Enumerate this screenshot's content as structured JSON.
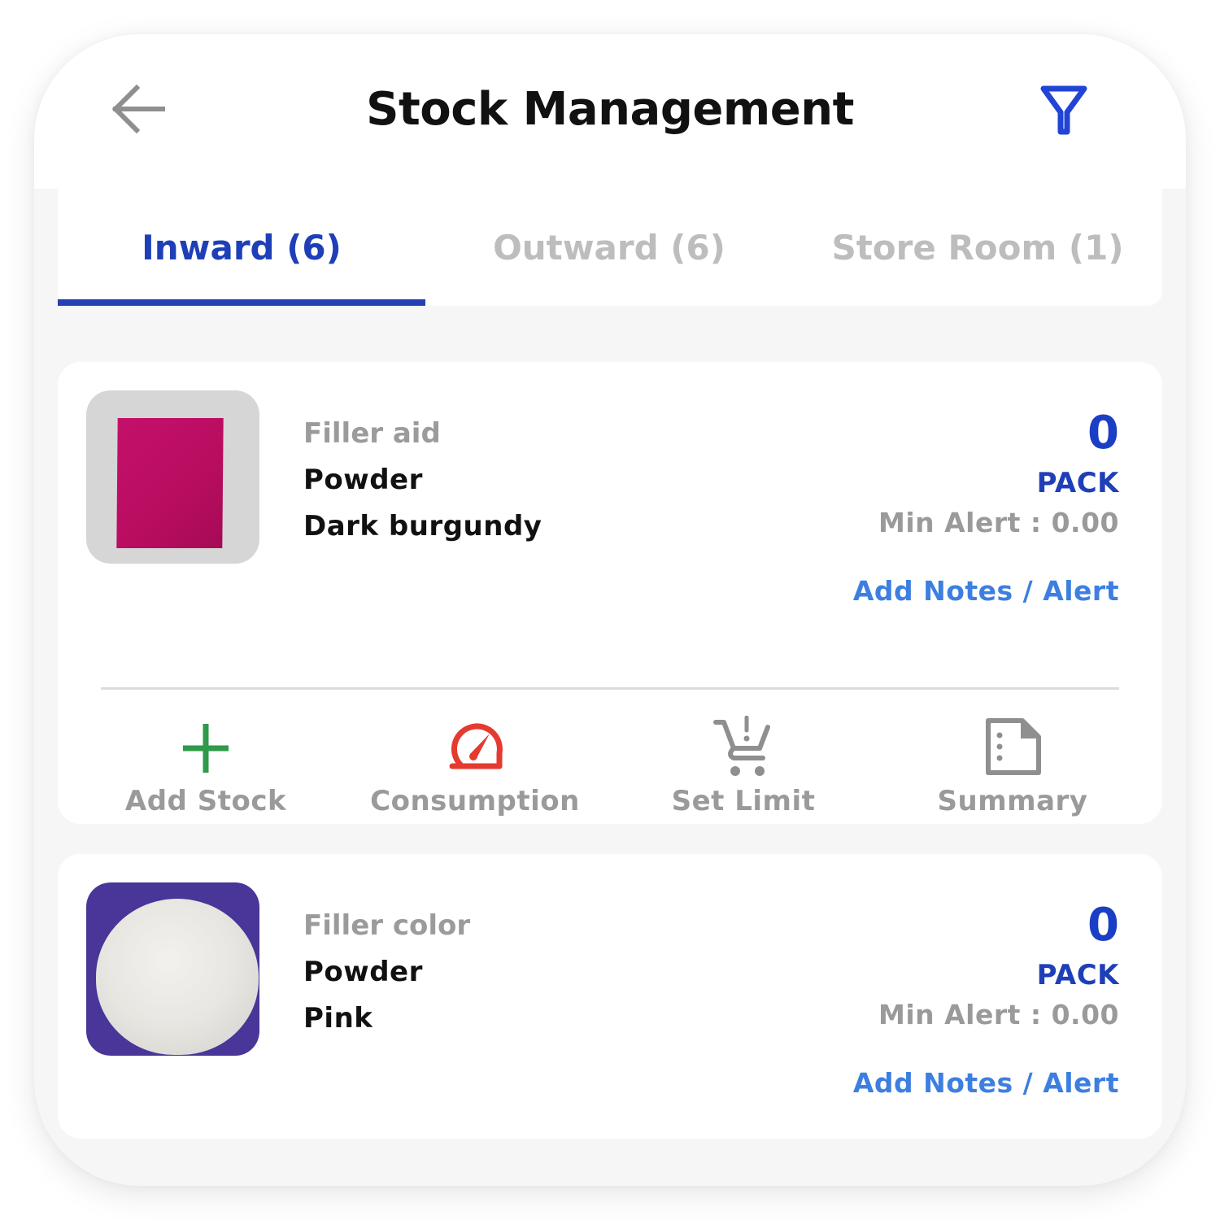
{
  "header": {
    "title": "Stock Management",
    "back_icon": "arrow-left-icon",
    "filter_icon": "filter-funnel-icon"
  },
  "tabs": [
    {
      "label": "Inward (6)",
      "active": true
    },
    {
      "label": "Outward (6)",
      "active": false
    },
    {
      "label": "Store Room (1)",
      "active": false
    }
  ],
  "items": [
    {
      "image": "magenta powder bag",
      "category": "Filler aid",
      "type": "Powder",
      "color": "Dark burgundy",
      "quantity": "0",
      "unit": "PACK",
      "min_alert": "Min Alert : 0.00",
      "notes_link": "Add Notes / Alert",
      "actions": [
        {
          "label": "Add Stock",
          "icon": "plus-icon"
        },
        {
          "label": "Consumption",
          "icon": "speedometer-icon"
        },
        {
          "label": "Set Limit",
          "icon": "cart-alert-icon"
        },
        {
          "label": "Summary",
          "icon": "document-icon"
        }
      ]
    },
    {
      "image": "white powder pile",
      "category": "Filler color",
      "type": "Powder",
      "color": "Pink",
      "quantity": "0",
      "unit": "PACK",
      "min_alert": "Min Alert : 0.00",
      "notes_link": "Add Notes / Alert"
    }
  ],
  "colors": {
    "accent": "#1f3fb8",
    "link": "#3d7fe0",
    "add": "#2e9a4a",
    "consumption": "#e53a2f",
    "muted": "#9a9a9a"
  }
}
